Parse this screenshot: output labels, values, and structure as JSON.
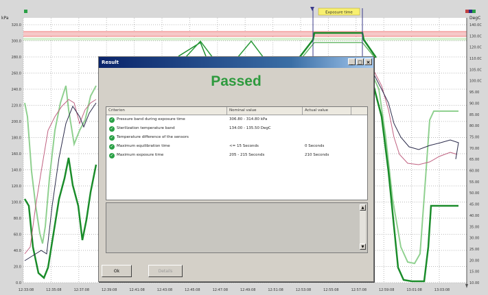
{
  "chart": {
    "left_unit": "kPa",
    "right_unit": "DegC",
    "exposure_label": "Exposure time",
    "left_ticks": [
      "320.0",
      "300.0",
      "280.0",
      "260.0",
      "240.0",
      "220.0",
      "200.0",
      "180.0",
      "160.0",
      "140.0",
      "120.0",
      "100.0",
      "80.0",
      "60.0",
      "40.0",
      "20.0",
      "0.0"
    ],
    "right_ticks": [
      "140.0C",
      "130.0C",
      "120.0C",
      "110.0C",
      "105.0C",
      "100.0C",
      "95.00",
      "90.00",
      "85.00",
      "80.00",
      "75.00",
      "70.00",
      "65.00",
      "60.00",
      "55.00",
      "50.00",
      "45.00",
      "40.00",
      "35.00",
      "30.00",
      "25.00",
      "20.00",
      "15.00",
      "10.00"
    ],
    "time_ticks": [
      "12:33:08",
      "12:35:08",
      "12:37:08",
      "12:39:08",
      "12:41:08",
      "12:43:08",
      "12:45:08",
      "12:47:08",
      "12:49:08",
      "12:51:08",
      "12:53:08",
      "12:55:08",
      "12:57:08",
      "12:59:08",
      "13:01:08",
      "13:03:08"
    ],
    "colors": {
      "grid": "#b8b8b8",
      "band": "#f08080",
      "dark_green": "#1a8c2a",
      "light_green": "#8fd08f",
      "dark_line": "#2a2a4a",
      "pink_line": "#c06080"
    }
  },
  "dialog": {
    "title": "Result",
    "status": "Passed",
    "status_color": "#2e9a3e",
    "columns": [
      "Criterion",
      "Nominal value",
      "Actual value"
    ],
    "rows": [
      {
        "criterion": "Pressure band during exposure time",
        "nominal": "306.80 - 314.80 kPa",
        "actual": ""
      },
      {
        "criterion": "Sterilization temperature band",
        "nominal": "134.00 - 135.50 DegC",
        "actual": ""
      },
      {
        "criterion": "Temperature difference of the sensors",
        "nominal": "",
        "actual": ""
      },
      {
        "criterion": "Maximum equilibration time",
        "nominal": "<= 15 Seconds",
        "actual": "0 Seconds"
      },
      {
        "criterion": "Maximum exposure time",
        "nominal": "205 - 215 Seconds",
        "actual": "210 Seconds"
      }
    ],
    "ok_label": "Ok",
    "details_label": "Details"
  }
}
